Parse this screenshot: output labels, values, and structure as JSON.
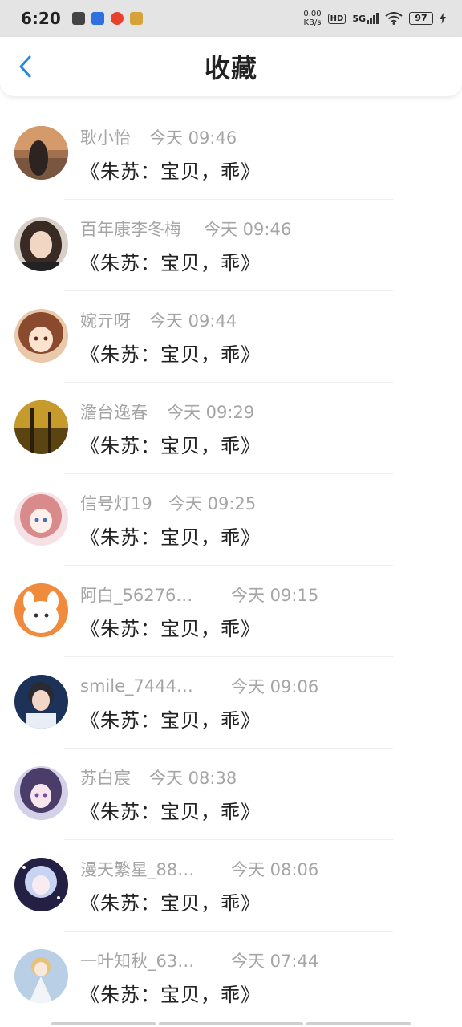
{
  "status_bar": {
    "time": "6:20",
    "net_speed_value": "0.00",
    "net_speed_unit": "KB/s",
    "hd": "HD",
    "network": "5G",
    "battery": "97"
  },
  "header": {
    "title": "收藏",
    "back_icon": "chevron-left-icon"
  },
  "colors": {
    "accent": "#1e88e5",
    "username": "#a5a5a5",
    "content": "#222222"
  },
  "items": [
    {
      "user": "耿小怡",
      "time": "今天 09:46",
      "content": "《朱苏：宝贝，乖》"
    },
    {
      "user": "百年康李冬梅",
      "time": "今天 09:46",
      "content": "《朱苏：宝贝，乖》"
    },
    {
      "user": "婉亓呀",
      "time": "今天 09:44",
      "content": "《朱苏：宝贝，乖》"
    },
    {
      "user": "澹台逸春",
      "time": "今天 09:29",
      "content": "《朱苏：宝贝，乖》"
    },
    {
      "user": "信号灯19",
      "time": "今天 09:25",
      "content": "《朱苏：宝贝，乖》"
    },
    {
      "user": "阿白_56276…",
      "time": "今天 09:15",
      "content": "《朱苏：宝贝，乖》"
    },
    {
      "user": "smile_7444…",
      "time": "今天 09:06",
      "content": "《朱苏：宝贝，乖》"
    },
    {
      "user": "苏白宸",
      "time": "今天 08:38",
      "content": "《朱苏：宝贝，乖》"
    },
    {
      "user": "漫天繁星_88…",
      "time": "今天 08:06",
      "content": "《朱苏：宝贝，乖》"
    },
    {
      "user": "一叶知秋_63…",
      "time": "今天 07:44",
      "content": "《朱苏：宝贝，乖》"
    }
  ]
}
